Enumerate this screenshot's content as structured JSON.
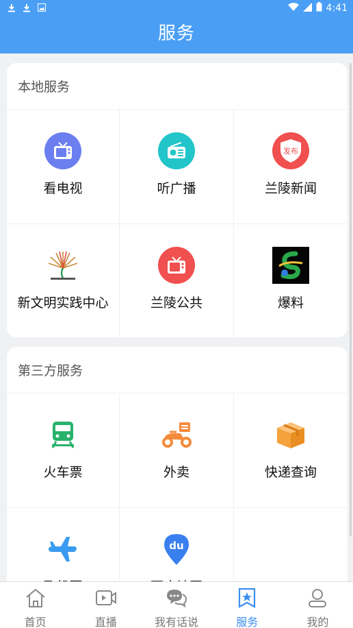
{
  "status_bar": {
    "time": "4:41"
  },
  "app_bar": {
    "title": "服务"
  },
  "local_services": {
    "heading": "本地服务",
    "items": [
      {
        "label": "看电视",
        "icon": "tv-icon",
        "color": "#6b7ff0"
      },
      {
        "label": "听广播",
        "icon": "radio-icon",
        "color": "#22c5c9"
      },
      {
        "label": "兰陵新闻",
        "icon": "news-shield-icon",
        "color": "#f0504f",
        "icon_text": "发布"
      },
      {
        "label": "新文明实践中心",
        "icon": "civilization-center-logo",
        "color": "#c7893a"
      },
      {
        "label": "兰陵公共",
        "icon": "tv-icon",
        "color": "#f0504f"
      },
      {
        "label": "爆料",
        "icon": "report-logo",
        "color": "#2aa84a"
      }
    ]
  },
  "third_party_services": {
    "heading": "第三方服务",
    "items": [
      {
        "label": "火车票",
        "icon": "train-icon",
        "color": "#27b26b"
      },
      {
        "label": "外卖",
        "icon": "scooter-icon",
        "color": "#f58a3c"
      },
      {
        "label": "快递查询",
        "icon": "package-icon",
        "color": "#f5a23c"
      },
      {
        "label": "飞机票",
        "icon": "airplane-icon",
        "color": "#3a9bf0"
      },
      {
        "label": "百度地图",
        "icon": "baidu-map-icon",
        "color": "#3a7ff0",
        "icon_text": "du"
      },
      {
        "label": "",
        "icon": "",
        "color": ""
      }
    ]
  },
  "tab_bar": {
    "tabs": [
      {
        "label": "首页",
        "icon": "home-icon"
      },
      {
        "label": "直播",
        "icon": "video-icon"
      },
      {
        "label": "我有话说",
        "icon": "chat-icon"
      },
      {
        "label": "服务",
        "icon": "service-star-icon",
        "active": true
      },
      {
        "label": "我的",
        "icon": "user-icon"
      }
    ]
  },
  "colors": {
    "primary": "#4a9ff5",
    "active_tab": "#3b8ef0"
  }
}
